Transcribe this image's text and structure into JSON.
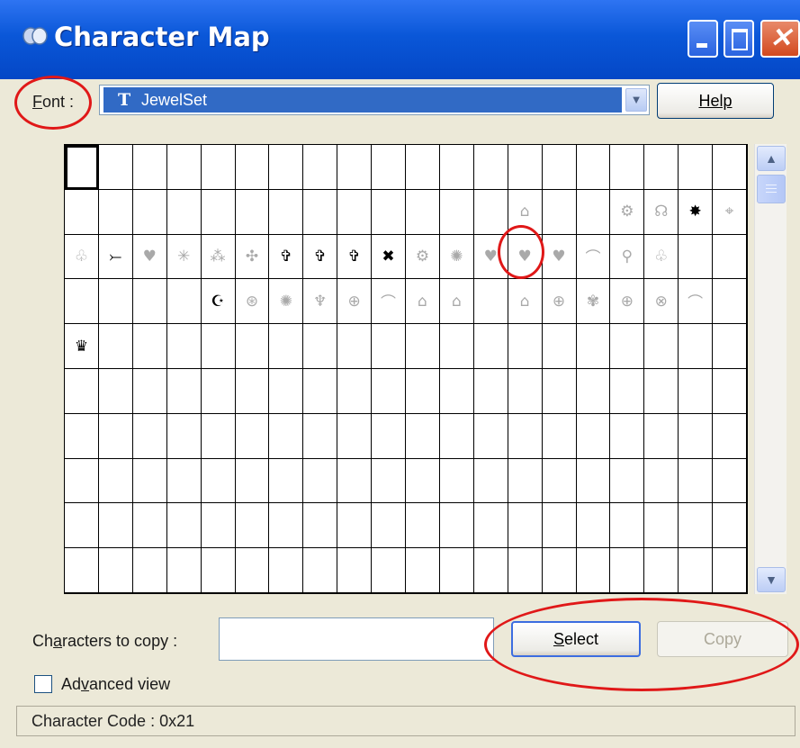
{
  "window": {
    "title": "Character Map"
  },
  "font": {
    "label_prefix": "",
    "label_accel": "F",
    "label_rest": "ont :",
    "selected_font": "JewelSet",
    "truetype_glyph": "T",
    "help_label": "Help"
  },
  "grid": {
    "selected_index": 0,
    "rows": [
      [
        "",
        "",
        "",
        "",
        "",
        "",
        "",
        "",
        "",
        "",
        "",
        "",
        "",
        "",
        "",
        "",
        "",
        "",
        "",
        ""
      ],
      [
        "",
        "",
        "",
        "",
        "",
        "",
        "",
        "",
        "",
        "",
        "",
        "",
        "",
        "⌂",
        "",
        "",
        "⚙",
        "☊",
        "✸",
        "⌖"
      ],
      [
        "♧",
        "⤚",
        "♥",
        "✳",
        "⁂",
        "✣",
        "✞",
        "✞",
        "✞",
        "✖",
        "⚙",
        "✺",
        "♥",
        "♥",
        "♥",
        "⌒",
        "⚲",
        "♧",
        "",
        ""
      ],
      [
        "",
        "",
        "",
        "",
        "☪",
        "⊛",
        "✺",
        "♆",
        "⊕",
        "⌒",
        "⌂",
        "⌂",
        "",
        "⌂",
        "⊕",
        "✾",
        "⊕",
        "⊗",
        "⌒",
        ""
      ],
      [
        "♛",
        "",
        "",
        "",
        "",
        "",
        "",
        "",
        "",
        "",
        "",
        "",
        "",
        "",
        "",
        "",
        "",
        "",
        "",
        ""
      ],
      [
        "",
        "",
        "",
        "",
        "",
        "",
        "",
        "",
        "",
        "",
        "",
        "",
        "",
        "",
        "",
        "",
        "",
        "",
        "",
        ""
      ],
      [
        "",
        "",
        "",
        "",
        "",
        "",
        "",
        "",
        "",
        "",
        "",
        "",
        "",
        "",
        "",
        "",
        "",
        "",
        "",
        ""
      ],
      [
        "",
        "",
        "",
        "",
        "",
        "",
        "",
        "",
        "",
        "",
        "",
        "",
        "",
        "",
        "",
        "",
        "",
        "",
        "",
        ""
      ],
      [
        "",
        "",
        "",
        "",
        "",
        "",
        "",
        "",
        "",
        "",
        "",
        "",
        "",
        "",
        "",
        "",
        "",
        "",
        "",
        ""
      ],
      [
        "",
        "",
        "",
        "",
        "",
        "",
        "",
        "",
        "",
        "",
        "",
        "",
        "",
        "",
        "",
        "",
        "",
        "",
        "",
        ""
      ]
    ]
  },
  "copy": {
    "label_prefix": "Ch",
    "label_accel": "a",
    "label_rest": "racters to copy :",
    "value": "",
    "select_prefix": "",
    "select_accel": "S",
    "select_rest": "elect",
    "copy_label": "Copy"
  },
  "advanced": {
    "label_prefix": "Ad",
    "label_accel": "v",
    "label_rest": "anced view",
    "checked": false
  },
  "status": {
    "text": "Character Code : 0x21"
  },
  "colors": {
    "title_bar": "#0a57d8",
    "selection": "#316ac5",
    "annotation": "#e01818"
  }
}
